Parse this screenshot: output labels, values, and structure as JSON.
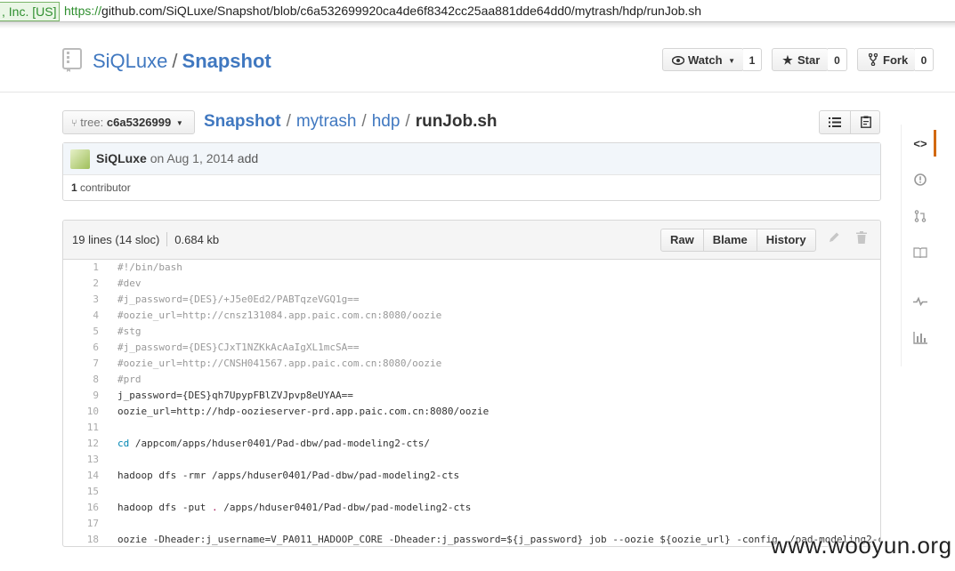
{
  "browser": {
    "ev_label": ", Inc. [US]",
    "url_scheme": "https://",
    "url_rest": "github.com/SiQLuxe/Snapshot/blob/c6a532699920ca4de6f8342cc25aa881dde64dd0/mytrash/hdp/runJob.sh"
  },
  "repo": {
    "owner": "SiQLuxe",
    "separator": "/",
    "name": "Snapshot",
    "watch_label": "Watch",
    "watch_count": "1",
    "star_label": "Star",
    "star_count": "0",
    "fork_label": "Fork",
    "fork_count": "0"
  },
  "nav": {
    "tree_label": "tree:",
    "tree_ref": "c6a5326999",
    "breadcrumb": [
      "Snapshot",
      "mytrash",
      "hdp"
    ],
    "sep": "/",
    "filename": "runJob.sh"
  },
  "commit": {
    "author": "SiQLuxe",
    "date": "on Aug 1, 2014",
    "message": "add",
    "contributors_count": "1",
    "contributors_label": "contributor"
  },
  "file": {
    "lines_info": "19 lines (14 sloc)",
    "size": "0.684 kb",
    "raw": "Raw",
    "blame": "Blame",
    "history": "History"
  },
  "code": [
    {
      "n": "1",
      "t": "#!/bin/bash",
      "type": "comment"
    },
    {
      "n": "2",
      "t": "#dev",
      "type": "comment"
    },
    {
      "n": "3",
      "t": "#j_password={DES}/+J5e0Ed2/PABTqzeVGQ1g==",
      "type": "comment"
    },
    {
      "n": "4",
      "t": "#oozie_url=http://cnsz131084.app.paic.com.cn:8080/oozie",
      "type": "comment"
    },
    {
      "n": "5",
      "t": "#stg",
      "type": "comment"
    },
    {
      "n": "6",
      "t": "#j_password={DES}CJxT1NZKkAcAaIgXL1mcSA==",
      "type": "comment"
    },
    {
      "n": "7",
      "t": "#oozie_url=http://CNSH041567.app.paic.com.cn:8080/oozie",
      "type": "comment"
    },
    {
      "n": "8",
      "t": "#prd",
      "type": "comment"
    },
    {
      "n": "9",
      "t": "j_password={DES}qh7UpypFBlZVJpvp8eUYAA==",
      "type": "plain"
    },
    {
      "n": "10",
      "t": "oozie_url=http://hdp-oozieserver-prd.app.paic.com.cn:8080/oozie",
      "type": "plain"
    },
    {
      "n": "11",
      "t": "",
      "type": "plain"
    },
    {
      "n": "12",
      "kw": "cd",
      "t": " /appcom/apps/hduser0401/Pad-dbw/pad-modeling2-cts/",
      "type": "kw"
    },
    {
      "n": "13",
      "t": "",
      "type": "plain"
    },
    {
      "n": "14",
      "t": "hadoop dfs -rmr /apps/hduser0401/Pad-dbw/pad-modeling2-cts",
      "type": "plain"
    },
    {
      "n": "15",
      "t": "",
      "type": "plain"
    },
    {
      "n": "16",
      "pre": "hadoop dfs -put ",
      "dot": ".",
      "t": " /apps/hduser0401/Pad-dbw/pad-modeling2-cts",
      "type": "dot"
    },
    {
      "n": "17",
      "t": "",
      "type": "plain"
    },
    {
      "n": "18",
      "t": "oozie -Dheader:j_username=V_PA011_HADOOP_CORE -Dheader:j_password=${j_password} job --oozie ${oozie_url} -config ./pad-modeling2-c",
      "type": "plain"
    }
  ],
  "watermark": "www.wooyun.org"
}
